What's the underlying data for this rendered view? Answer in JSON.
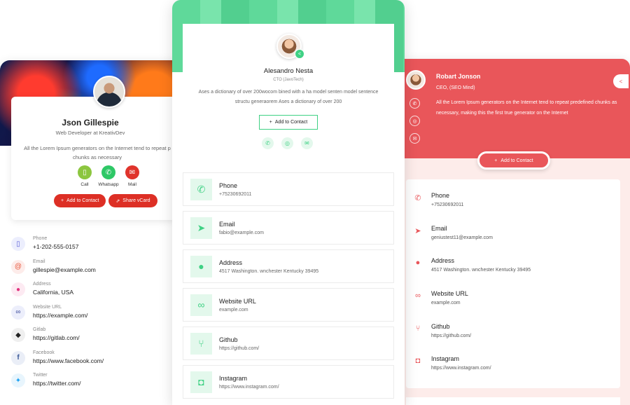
{
  "left_card": {
    "name": "Json Gillespie",
    "role": "Web Developer at KreativDev",
    "description": "All the Lorem Ipsum generators on the Internet tend to repeat p chunks as necessary",
    "actions": [
      {
        "label": "Call",
        "icon": "phone-icon",
        "color": "#8cc63f"
      },
      {
        "label": "Whatsapp",
        "icon": "whatsapp-icon",
        "color": "#2ec866"
      },
      {
        "label": "Mail",
        "icon": "mail-icon",
        "color": "#e0342c"
      }
    ],
    "add_contact_label": "Add to Contact",
    "share_label": "Share vCard",
    "contacts": [
      {
        "key": "Phone",
        "value": "+1-202-555-0157",
        "icon": "phone-icon",
        "color": "#5b5fd8",
        "bg": "#eceefd"
      },
      {
        "key": "Email",
        "value": "gillespie@example.com",
        "icon": "at-icon",
        "color": "#e8563b",
        "bg": "#fdecea"
      },
      {
        "key": "Address",
        "value": "California, USA",
        "icon": "pin-icon",
        "color": "#e0337f",
        "bg": "#fdeaf2"
      },
      {
        "key": "Website URL",
        "value": "https://example.com/",
        "icon": "link-icon",
        "color": "#3b4a9a",
        "bg": "#eceefb"
      },
      {
        "key": "Gitlab",
        "value": "https://gitlab.com/",
        "icon": "gitlab-icon",
        "color": "#222222",
        "bg": "#efefef"
      },
      {
        "key": "Facebook",
        "value": "https://www.facebook.com/",
        "icon": "facebook-icon",
        "color": "#3b5998",
        "bg": "#eaeef7"
      },
      {
        "key": "Twitter",
        "value": "https://twitter.com/",
        "icon": "twitter-icon",
        "color": "#1da1f2",
        "bg": "#e8f5fd"
      }
    ]
  },
  "middle_card": {
    "name": "Alesandro Nesta",
    "role": "CTO (JavoTech)",
    "description": "Ases a dictionary of over 200wocom bined with a ha model senten model sentence structu generaorem Ases a dictionary of over 200",
    "add_contact_label": "Add to Contact",
    "quick_icons": [
      "phone-icon",
      "whatsapp-icon",
      "mail-icon"
    ],
    "accent": "#3fd184",
    "items": [
      {
        "title": "Phone",
        "value": "+75230692011",
        "icon": "phone-icon"
      },
      {
        "title": "Email",
        "value": "fabio@example.com",
        "icon": "send-icon"
      },
      {
        "title": "Address",
        "value": "4517 Washington. wnchester Kentucky 39495",
        "icon": "pin-icon"
      },
      {
        "title": "Website URL",
        "value": "example.com",
        "icon": "link-icon"
      },
      {
        "title": "Github",
        "value": "https://github.com/",
        "icon": "git-branch-icon"
      },
      {
        "title": "Instagram",
        "value": "https://www.instagram.com/",
        "icon": "instagram-icon"
      }
    ]
  },
  "right_card": {
    "name": "Robart Jonson",
    "role": "CEO, (SEO Mind)",
    "description": "All the Lorem Ipsum generators on the Internet tend to repeat predefined chunks as necessary, making this the first true generator on the Internet",
    "add_contact_label": "Add to Contact",
    "accent": "#e9565a",
    "items": [
      {
        "title": "Phone",
        "value": "+75230692011",
        "icon": "phone-icon"
      },
      {
        "title": "Email",
        "value": "geniustest11@example.com",
        "icon": "send-icon"
      },
      {
        "title": "Address",
        "value": "4517 Washington. wnchester Kentucky 39495",
        "icon": "pin-icon"
      },
      {
        "title": "Website URL",
        "value": "example.com",
        "icon": "link-icon"
      },
      {
        "title": "Github",
        "value": "https://github.com/",
        "icon": "git-branch-icon"
      },
      {
        "title": "Instagram",
        "value": "https://www.instagram.com/",
        "icon": "instagram-icon"
      }
    ]
  }
}
